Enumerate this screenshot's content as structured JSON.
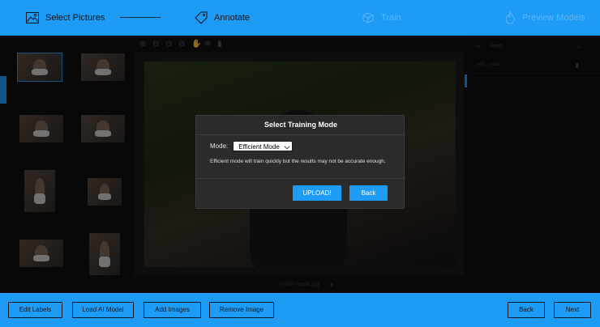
{
  "stepper": {
    "steps": [
      {
        "label": "Select Pictures",
        "icon": "image-icon",
        "state": "active"
      },
      {
        "label": "Annotate",
        "icon": "tag-icon",
        "state": "active"
      },
      {
        "label": "Train",
        "icon": "cube-icon",
        "state": "disabled"
      },
      {
        "label": "Preview Models",
        "icon": "flame-icon",
        "state": "disabled"
      }
    ]
  },
  "viewer": {
    "filename": "0-with-mask.jpg"
  },
  "labels_panel": {
    "header": "Rect",
    "items": [
      {
        "name": "with_mask"
      }
    ]
  },
  "modal": {
    "title": "Select Training Mode",
    "mode_label": "Mode:",
    "mode_selected": "Efficient Mode",
    "description": "Efficient mode will train quickly but the results may not be accurate enough.",
    "upload_label": "UPLOAD!",
    "back_label": "Back"
  },
  "bottom_bar": {
    "edit_labels": "Edit Labels",
    "load_ai_model": "Load AI Model",
    "add_images": "Add Images",
    "remove_image": "Remove Image",
    "back": "Back",
    "next": "Next"
  },
  "colors": {
    "accent": "#1e9bf5",
    "background": "#111111",
    "modal_bg": "#2b2b2b"
  }
}
